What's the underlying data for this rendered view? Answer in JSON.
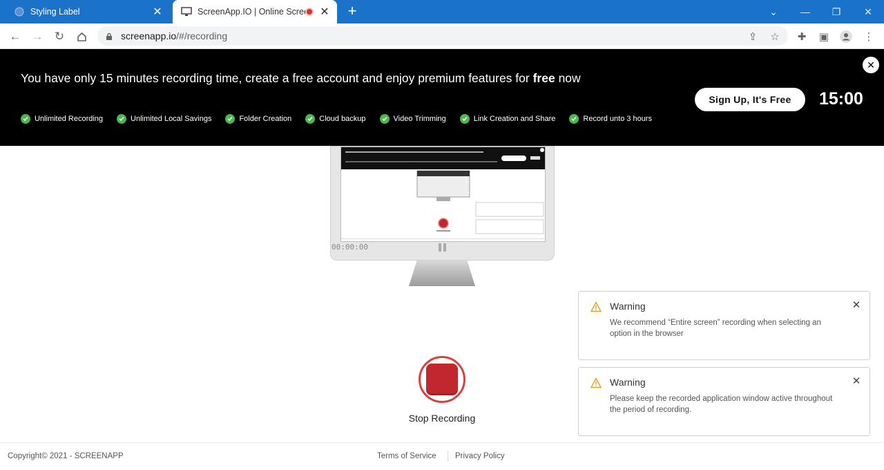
{
  "browser": {
    "tabs": [
      {
        "title": "Styling Label",
        "active": false
      },
      {
        "title": "ScreenApp.IO | Online Screen",
        "active": true
      }
    ],
    "url_host": "screenapp.io",
    "url_path": "/#/recording"
  },
  "banner": {
    "headline_prefix": "You have only 15 minutes recording time, create a free account and enjoy premium features for",
    "headline_bold": "free",
    "headline_suffix": "now",
    "features": [
      "Unlimited Recording",
      "Unlimited Local Savings",
      "Folder Creation",
      "Cloud backup",
      "Video Trimming",
      "Link Creation and Share",
      "Record unto 3 hours"
    ],
    "signup_label": "Sign Up, It's Free",
    "timer": "15:00"
  },
  "preview": {
    "elapsed": "00:00:00"
  },
  "recording": {
    "stop_label": "Stop Recording"
  },
  "toasts": [
    {
      "title": "Warning",
      "message": "We recommend “Entire screen” recording when selecting an option in the browser"
    },
    {
      "title": "Warning",
      "message": "Please keep the recorded application window active throughout the period of recording."
    }
  ],
  "footer": {
    "copyright": "Copyright©   2021 - SCREENAPP",
    "terms": "Terms of Service",
    "privacy": "Privacy Policy"
  },
  "colors": {
    "tabstrip": "#1a73c8",
    "banner_bg": "#000000",
    "check_green": "#4ab84a",
    "stop_red": "#c0282d",
    "warning_amber": "#e0a020"
  }
}
